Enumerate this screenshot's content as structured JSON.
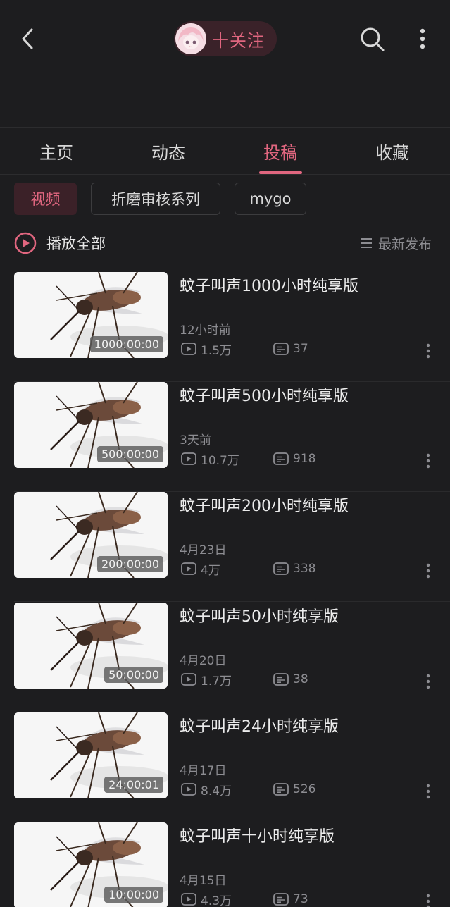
{
  "header": {
    "back_icon": "chevron-left-icon",
    "follow_label": "十关注",
    "search_icon": "search-icon",
    "more_icon": "more-vertical-icon"
  },
  "tabs": [
    {
      "label": "主页",
      "active": false
    },
    {
      "label": "动态",
      "active": false
    },
    {
      "label": "投稿",
      "active": true
    },
    {
      "label": "收藏",
      "active": false
    }
  ],
  "filters": [
    {
      "label": "视频",
      "active": true
    },
    {
      "label": "折磨审核系列",
      "active": false
    },
    {
      "label": "mygo",
      "active": false
    }
  ],
  "play_all_label": "播放全部",
  "sort_label": "最新发布",
  "colors": {
    "accent": "#e0667f",
    "background": "#1d1d1f",
    "muted": "#8d8d92"
  },
  "videos": [
    {
      "title": "蚊子叫声1000小时纯享版",
      "duration": "1000:00:00",
      "date": "12小时前",
      "views": "1.5万",
      "comments": "37"
    },
    {
      "title": "蚊子叫声500小时纯享版",
      "duration": "500:00:00",
      "date": "3天前",
      "views": "10.7万",
      "comments": "918"
    },
    {
      "title": "蚊子叫声200小时纯享版",
      "duration": "200:00:00",
      "date": "4月23日",
      "views": "4万",
      "comments": "338"
    },
    {
      "title": "蚊子叫声50小时纯享版",
      "duration": "50:00:00",
      "date": "4月20日",
      "views": "1.7万",
      "comments": "38"
    },
    {
      "title": "蚊子叫声24小时纯享版",
      "duration": "24:00:01",
      "date": "4月17日",
      "views": "8.4万",
      "comments": "526"
    },
    {
      "title": "蚊子叫声十小时纯享版",
      "duration": "10:00:00",
      "date": "4月15日",
      "views": "4.3万",
      "comments": "73"
    }
  ]
}
